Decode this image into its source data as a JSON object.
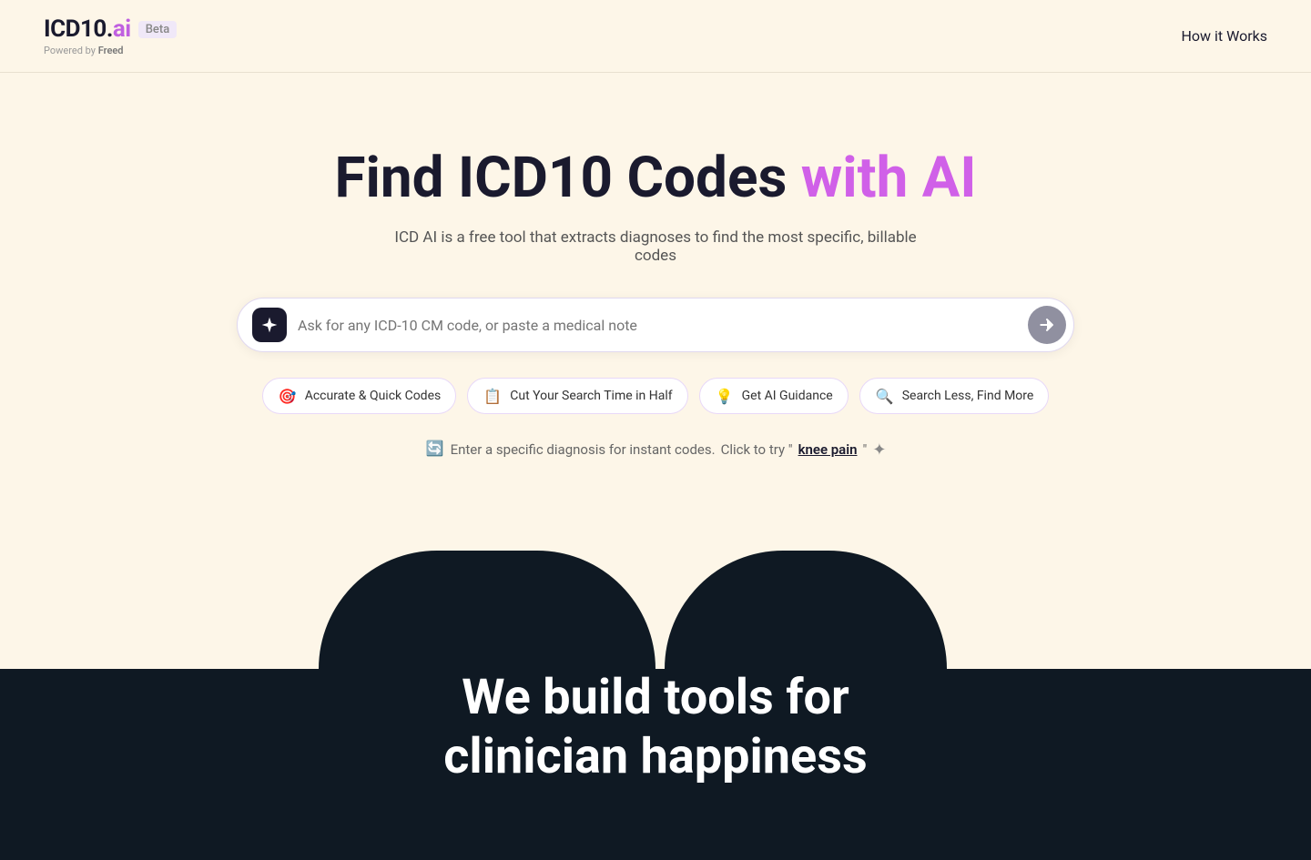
{
  "header": {
    "logo_icd10": "ICD10.",
    "logo_ai": "ai",
    "beta_label": "Beta",
    "powered_prefix": "Powered by ",
    "freed_label": "Freed",
    "nav_how_it_works": "How it Works"
  },
  "hero": {
    "title_part1": "Find ICD10 Codes ",
    "title_part2": "with AI",
    "subtitle": "ICD AI is a free tool that extracts diagnoses to find the most specific, billable codes",
    "search_placeholder": "Ask for any ICD-10 CM code, or paste a medical note"
  },
  "chips": [
    {
      "id": "chip-accurate",
      "icon": "🎯",
      "label": "Accurate & Quick Codes"
    },
    {
      "id": "chip-search-time",
      "icon": "📋",
      "label": "Cut Your Search Time in Half"
    },
    {
      "id": "chip-ai-guidance",
      "icon": "💡",
      "label": "Get AI Guidance"
    },
    {
      "id": "chip-search-less",
      "icon": "🔍",
      "label": "Search Less, Find More"
    }
  ],
  "hint": {
    "prefix": "Enter a specific diagnosis for instant codes.",
    "cta_prefix": "Click to try \"",
    "cta_link": "knee pain",
    "cta_suffix": "\""
  },
  "bottom": {
    "title_line1": "We build tools for",
    "title_line2": "clinician happiness"
  },
  "colors": {
    "brand_purple": "#c060e0",
    "dark_bg": "#0f1923",
    "light_bg": "#fdf6e8"
  }
}
